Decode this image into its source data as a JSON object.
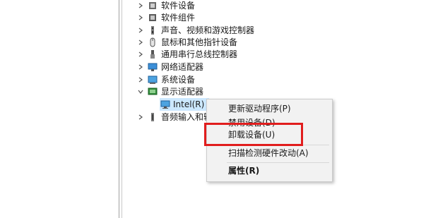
{
  "tree": {
    "items": [
      {
        "label": "软件设备",
        "icon": "software-device-icon",
        "expanded": false
      },
      {
        "label": "软件组件",
        "icon": "software-component-icon",
        "expanded": false
      },
      {
        "label": "声音、视频和游戏控制器",
        "icon": "speaker-icon",
        "expanded": false
      },
      {
        "label": "鼠标和其他指针设备",
        "icon": "mouse-icon",
        "expanded": false
      },
      {
        "label": "通用串行总线控制器",
        "icon": "usb-icon",
        "expanded": false
      },
      {
        "label": "网络适配器",
        "icon": "network-adapter-icon",
        "expanded": false
      },
      {
        "label": "系统设备",
        "icon": "system-device-icon",
        "expanded": false
      },
      {
        "label": "显示适配器",
        "icon": "display-adapter-icon",
        "expanded": true
      },
      {
        "label": "Intel(R) U",
        "icon": "monitor-icon",
        "child": true,
        "selected": true
      },
      {
        "label": "音频输入和输",
        "icon": "audio-io-icon",
        "expanded": false
      }
    ]
  },
  "context_menu": {
    "items": [
      {
        "label": "更新驱动程序(P)"
      },
      {
        "label": "禁用设备(D)"
      },
      {
        "label": "卸载设备(U)",
        "highlighted": true
      },
      {
        "label": "扫描检测硬件改动(A)"
      },
      {
        "label": "属性(R)",
        "bold": true
      }
    ]
  },
  "colors": {
    "highlight_border": "#e11d1d",
    "selection_bg": "#cce8ff",
    "menu_bg": "#f2f2f2"
  }
}
